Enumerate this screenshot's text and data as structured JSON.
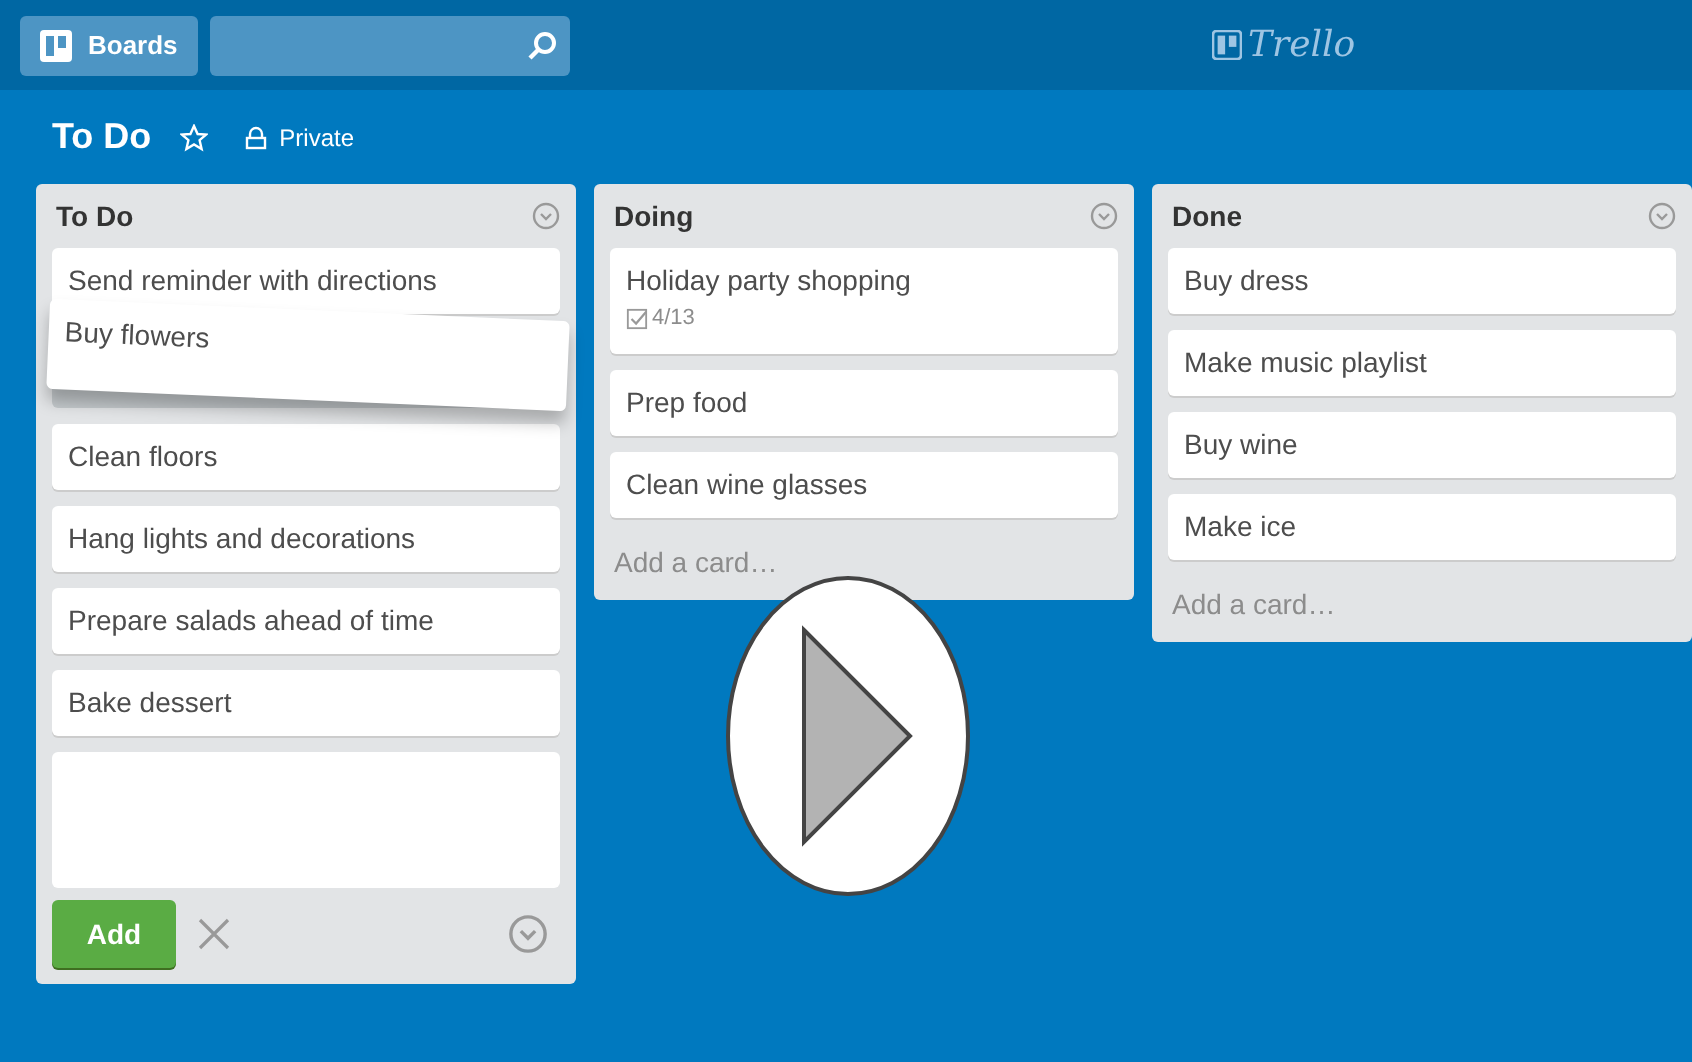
{
  "header": {
    "boards_button": "Boards",
    "logo": "Trello"
  },
  "board": {
    "title": "To Do",
    "starred": false,
    "visibility": "Private"
  },
  "lists": [
    {
      "title": "To Do",
      "cards": [
        {
          "text": "Send reminder with directions",
          "kind": "card"
        },
        {
          "text": "Buy flowers",
          "kind": "dragging"
        },
        {
          "text": "Clean floors",
          "kind": "card"
        },
        {
          "text": "Hang lights and decorations",
          "kind": "card"
        },
        {
          "text": "Prepare salads ahead of time",
          "kind": "card"
        },
        {
          "text": "Bake dessert",
          "kind": "card"
        }
      ],
      "footer": {
        "kind": "composer",
        "button": "Add"
      }
    },
    {
      "title": "Doing",
      "cards": [
        {
          "text": "Holiday party shopping",
          "kind": "card",
          "checklist": "4/13"
        },
        {
          "text": "Prep food",
          "kind": "card"
        },
        {
          "text": "Clean wine glasses",
          "kind": "card"
        }
      ],
      "footer": {
        "kind": "add_link",
        "text": "Add a card…"
      }
    },
    {
      "title": "Done",
      "cards": [
        {
          "text": "Buy dress",
          "kind": "card"
        },
        {
          "text": "Make music playlist",
          "kind": "card"
        },
        {
          "text": "Buy wine",
          "kind": "card"
        },
        {
          "text": "Make ice",
          "kind": "card"
        }
      ],
      "footer": {
        "kind": "add_link",
        "text": "Add a card…"
      }
    }
  ],
  "video": {
    "kind": "play_overlay"
  }
}
